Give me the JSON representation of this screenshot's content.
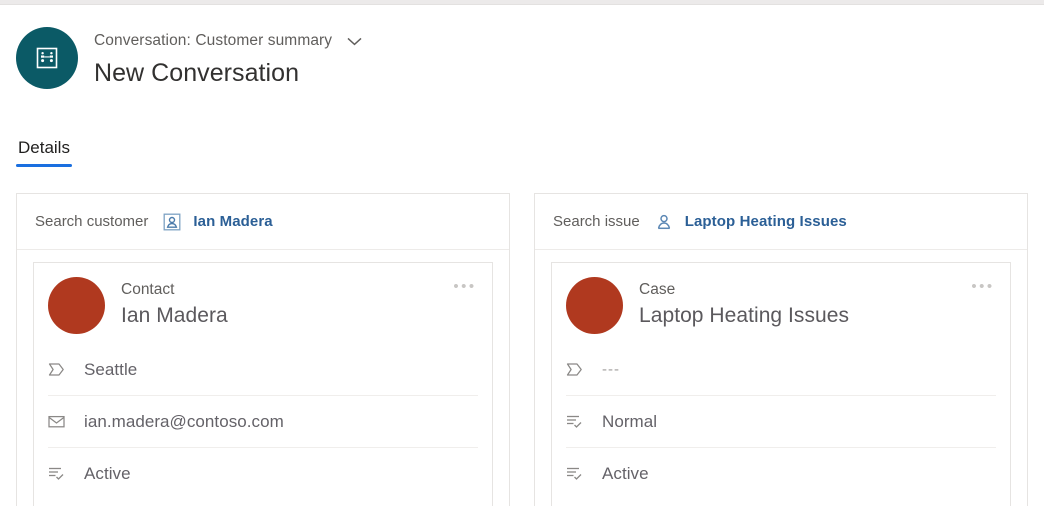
{
  "header": {
    "avatar_icon": "conversation-icon",
    "breadcrumb": "Conversation: Customer summary",
    "chevron_icon": "chevron-down-icon",
    "title": "New Conversation"
  },
  "tabs": [
    {
      "label": "Details",
      "selected": true
    }
  ],
  "colors": {
    "accent_blue": "#1a6fe0",
    "link_blue": "#2b5f96",
    "avatar_teal": "#0b5a66",
    "record_avatar_red": "#b0391f"
  },
  "cards": [
    {
      "search_label": "Search customer",
      "lookup_icon": "contact-lookup-icon",
      "lookup_value": "Ian Madera",
      "record": {
        "type": "Contact",
        "name": "Ian Madera",
        "more_label": "•••",
        "more_icon": "more-options-icon",
        "rows": [
          {
            "icon": "location-icon",
            "value": "Seattle",
            "muted": false
          },
          {
            "icon": "email-icon",
            "value": "ian.madera@contoso.com",
            "muted": false
          },
          {
            "icon": "status-icon",
            "value": "Active",
            "muted": false
          }
        ]
      }
    },
    {
      "search_label": "Search issue",
      "lookup_icon": "case-lookup-icon",
      "lookup_value": "Laptop Heating Issues",
      "record": {
        "type": "Case",
        "name": "Laptop Heating Issues",
        "more_label": "•••",
        "more_icon": "more-options-icon",
        "rows": [
          {
            "icon": "location-icon",
            "value": "---",
            "muted": true
          },
          {
            "icon": "priority-icon",
            "value": "Normal",
            "muted": false
          },
          {
            "icon": "status-icon",
            "value": "Active",
            "muted": false
          }
        ]
      }
    }
  ]
}
